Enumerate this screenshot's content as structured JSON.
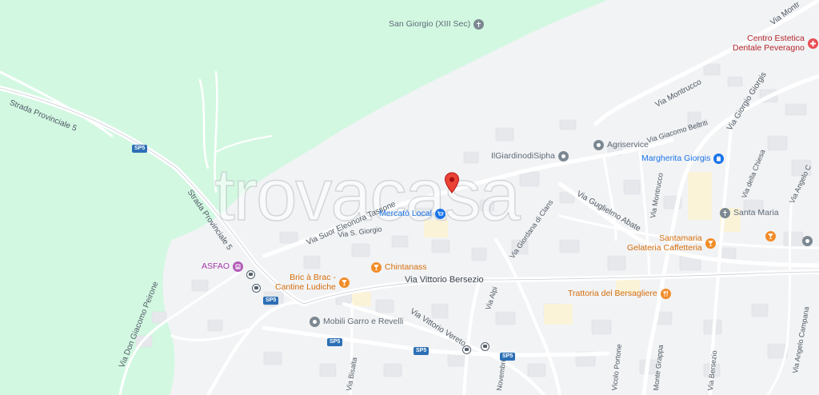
{
  "map": {
    "watermark": "trovacasa",
    "roads": [
      {
        "id": "sp5-top",
        "text": "Strada Provinciale 5"
      },
      {
        "id": "sp5-mid",
        "text": "Strada Provinciale 5"
      },
      {
        "id": "montrucco",
        "text": "Via Montrucco"
      },
      {
        "id": "montr-top",
        "text": "Via Montr"
      },
      {
        "id": "beltriti",
        "text": "Via Giacomo Beltriti"
      },
      {
        "id": "giorgis",
        "text": "Via Giorgio Giorgis"
      },
      {
        "id": "della-chiesa",
        "text": "Via della Chiesa"
      },
      {
        "id": "angelo-c",
        "text": "Via Angelo C"
      },
      {
        "id": "tassone",
        "text": "Via Suor Eleonora Tassone"
      },
      {
        "id": "sgiorgio",
        "text": "Via S. Giorgio"
      },
      {
        "id": "abate",
        "text": "Via Guglielmo Abate"
      },
      {
        "id": "montrucco2",
        "text": "Via Montrucco"
      },
      {
        "id": "giordana",
        "text": "Via Giordana di Clans"
      },
      {
        "id": "bersezio",
        "text": "Via Vittorio Bersezio"
      },
      {
        "id": "alpi",
        "text": "Via Alpi"
      },
      {
        "id": "vereto",
        "text": "Via Vittorio Vereto"
      },
      {
        "id": "peirone",
        "text": "Via Don Giacomo Peirone"
      },
      {
        "id": "bisalta",
        "text": "Via Bisalta"
      },
      {
        "id": "novembre",
        "text": "Novembre"
      },
      {
        "id": "portone",
        "text": "Vicolo Portone"
      },
      {
        "id": "grappa",
        "text": "Monte Grappa"
      },
      {
        "id": "bersezio2",
        "text": "Via Bersezio"
      },
      {
        "id": "campana",
        "text": "Via Angelo Campana"
      }
    ],
    "shields": [
      "SP5",
      "SP5",
      "SP5",
      "SP5",
      "SP5"
    ],
    "pois": [
      {
        "id": "san-giorgio",
        "lines": [
          "San Giorgio (XIII Sec)"
        ],
        "icon": "cross-icon",
        "color": "#7c8892"
      },
      {
        "id": "centro-estetica",
        "lines": [
          "Centro Estetica",
          "Dentale Peveragno"
        ],
        "icon": "medical-icon",
        "color": "#e94e54"
      },
      {
        "id": "agriservice",
        "lines": [
          "Agriservice"
        ],
        "icon": "shop-icon",
        "color": "#7c8892"
      },
      {
        "id": "giardino",
        "lines": [
          "IlGiardinodiSipha"
        ],
        "icon": "shop-icon",
        "color": "#7c8892"
      },
      {
        "id": "margherita",
        "lines": [
          "Margherita Giorgis"
        ],
        "icon": "bag-icon",
        "color": "#1a73e8"
      },
      {
        "id": "mercato",
        "lines": [
          "Mercatò Local"
        ],
        "icon": "cart-icon",
        "color": "#1a73e8"
      },
      {
        "id": "santa-maria",
        "lines": [
          "Santa Maria"
        ],
        "icon": "cross-icon",
        "color": "#7c8892"
      },
      {
        "id": "santamaria-gel",
        "lines": [
          "Santamaria",
          "Gelateria Caffetteria"
        ],
        "icon": "glass-icon",
        "color": "#f28c28"
      },
      {
        "id": "asfao",
        "lines": [
          "ASFAO"
        ],
        "icon": "building-icon",
        "color": "#b35ab8"
      },
      {
        "id": "chintanass",
        "lines": [
          "Chintanass"
        ],
        "icon": "glass-icon",
        "color": "#f28c28"
      },
      {
        "id": "bric",
        "lines": [
          "Bric à Brac -",
          "Cantine Ludiche"
        ],
        "icon": "glass-icon",
        "color": "#f28c28"
      },
      {
        "id": "trattoria",
        "lines": [
          "Trattoria del Bersagliere"
        ],
        "icon": "fork-icon",
        "color": "#f28c28"
      },
      {
        "id": "mobili",
        "lines": [
          "Mobili Garro e Revelli"
        ],
        "icon": "shop-icon",
        "color": "#7c8892"
      }
    ]
  }
}
